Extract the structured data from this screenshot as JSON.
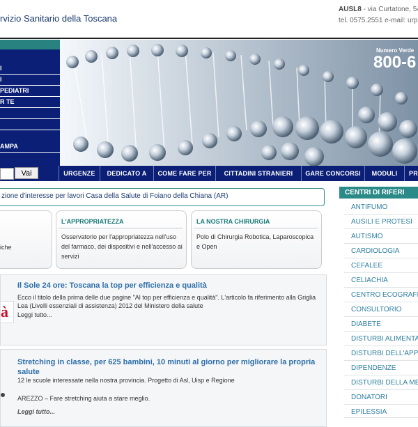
{
  "header": {
    "site_title": "rvizio Sanitario della Toscana",
    "ausl_name": "AUSL8",
    "ausl_address": " - via Curtatone, 54",
    "ausl_contacts": "tel. 0575.2551 e-mail: urp@"
  },
  "left_menu": {
    "items": [
      "I",
      "I",
      "PEDIATRI",
      "R TE",
      "",
      "",
      "AMPA"
    ]
  },
  "banner": {
    "numero_verde_label": "Numero Verde",
    "numero_verde": "800-6"
  },
  "search": {
    "value": "",
    "button_label": "Vai"
  },
  "nav": {
    "tabs": [
      "URGENZE",
      "DEDICATO A",
      "COME FARE PER",
      "CITTADINI STRANIERI",
      "GARE CONCORSI",
      "MODULI",
      "PR"
    ]
  },
  "ticker": {
    "text": "zione d'interesse per lavori Casa della Salute di Foiano della Chiana (AR)"
  },
  "boxes": [
    {
      "title": "",
      "text": "iche"
    },
    {
      "title": "L'APPROPRIATEZZA",
      "text": "Osservatorio per l'appropriatezza nell'uso del farmaco, dei dispositivi e nell'accesso ai servizi"
    },
    {
      "title": "LA NOSTRA CHIRURGIA",
      "text": "Polo di Chirurgia Robotica, Laparoscopica e Open"
    }
  ],
  "articles": [
    {
      "title": "Il Sole 24 ore: Toscana la top per efficienza e qualità",
      "text": "Ecco il titolo della prima delle due pagine \"Al top per efficienza e qualità\". L'articolo fa riferimento alla Griglia Lea (Livelli essenziali di assistenza) 2012 del Ministero della salute",
      "more": "Leggi tutto...",
      "logo_text": "à"
    },
    {
      "title": "Stretching in classe, per 625 bambini, 10 minuti al giorno per migliorare la propria salute",
      "text": "12 le scuole interessate nella nostra provincia. Progetto di Asl, Uisp e Regione",
      "text2": "AREZZO – Fare stretching  aiuta a stare meglio.",
      "more": "Leggi tutto..."
    }
  ],
  "centri": {
    "header": "CENTRI DI RIFERI",
    "items": [
      "ANTIFUMO",
      "AUSILI E PROTESI",
      "AUTISMO",
      "CARDIOLOGIA",
      "CEFALEE",
      "CELIACHIA",
      "CENTRO ECOGRAFIC",
      "CONSULTORIO",
      "DIABETE",
      "DISTURBI ALIMENTA",
      "DISTURBI DELL'APPR",
      "DIPENDENZE",
      "DISTURBI DELLA ME",
      "DONATORI",
      "EPILESSIA"
    ]
  },
  "colors": {
    "nav_bg": "#0b1f77",
    "teal": "#2a8a88",
    "link_blue": "#2d6ea8"
  }
}
